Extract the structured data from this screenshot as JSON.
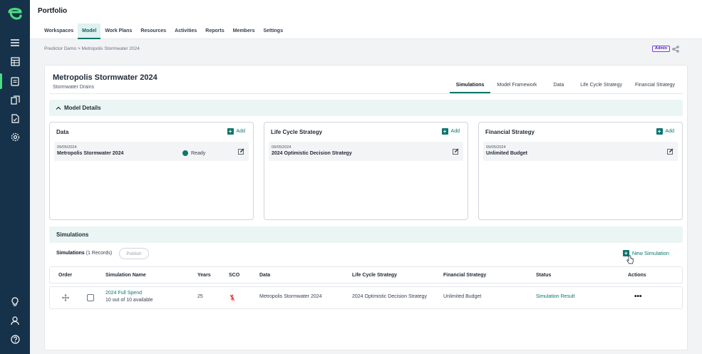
{
  "app": {
    "title": "Portfolio"
  },
  "sidebar": {
    "logo": "logo-icon",
    "items": [
      {
        "icon": "menu-icon"
      },
      {
        "icon": "table-icon"
      },
      {
        "icon": "model-icon",
        "active": true
      },
      {
        "icon": "copy-icon"
      },
      {
        "icon": "report-icon"
      },
      {
        "icon": "settings-gear-icon"
      }
    ],
    "bottom": [
      {
        "icon": "lightbulb-icon"
      },
      {
        "icon": "user-icon"
      },
      {
        "icon": "help-icon"
      }
    ],
    "accent": "#4ade80"
  },
  "nav": {
    "tabs": [
      "Workspaces",
      "Model",
      "Work Plans",
      "Resources",
      "Activities",
      "Reports",
      "Members",
      "Settings"
    ],
    "active": "Model"
  },
  "breadcrumb": "Predictor Demo > Metropolis Stormwater 2024",
  "badge": "Admin",
  "model": {
    "title": "Metropolis Stormwater 2024",
    "subtitle": "Stormwater Drains",
    "tabs": [
      "Simulations",
      "Model Framework",
      "Data",
      "Life Cycle Strategy",
      "Financial Strategy"
    ],
    "active_tab": "Simulations"
  },
  "details": {
    "header": "Model Details",
    "add_label": "Add",
    "cards": [
      {
        "title": "Data",
        "date": "09/05/2024",
        "name": "Metropolis Stormwater 2024",
        "status": "Ready"
      },
      {
        "title": "Life Cycle Strategy",
        "date": "09/05/2024",
        "name": "2024 Optimistic Decision Strategy"
      },
      {
        "title": "Financial Strategy",
        "date": "09/05/2024",
        "name": "Unlimited Budget"
      }
    ]
  },
  "simulations": {
    "header": "Simulations",
    "label": "Simulations",
    "count": "(1 Records)",
    "publish": "Publish",
    "new_label": "New Simulation",
    "columns": [
      "Order",
      "Simulation Name",
      "Years",
      "SCO",
      "Data",
      "Life Cycle Strategy",
      "Financial Strategy",
      "Status",
      "Actions"
    ],
    "rows": [
      {
        "name": "2024 Full Spend",
        "availability": "10 out of 10 available",
        "years": "25",
        "data": "Metropolis Stormwater 2024",
        "lcs": "2024 Optimistic Decision Strategy",
        "fs": "Unlimited Budget",
        "status": "Simulation Result",
        "actions": "•••"
      }
    ]
  },
  "colors": {
    "brand": "#0f766e",
    "sidebar": "#16324a",
    "section": "#eaf5f4"
  }
}
